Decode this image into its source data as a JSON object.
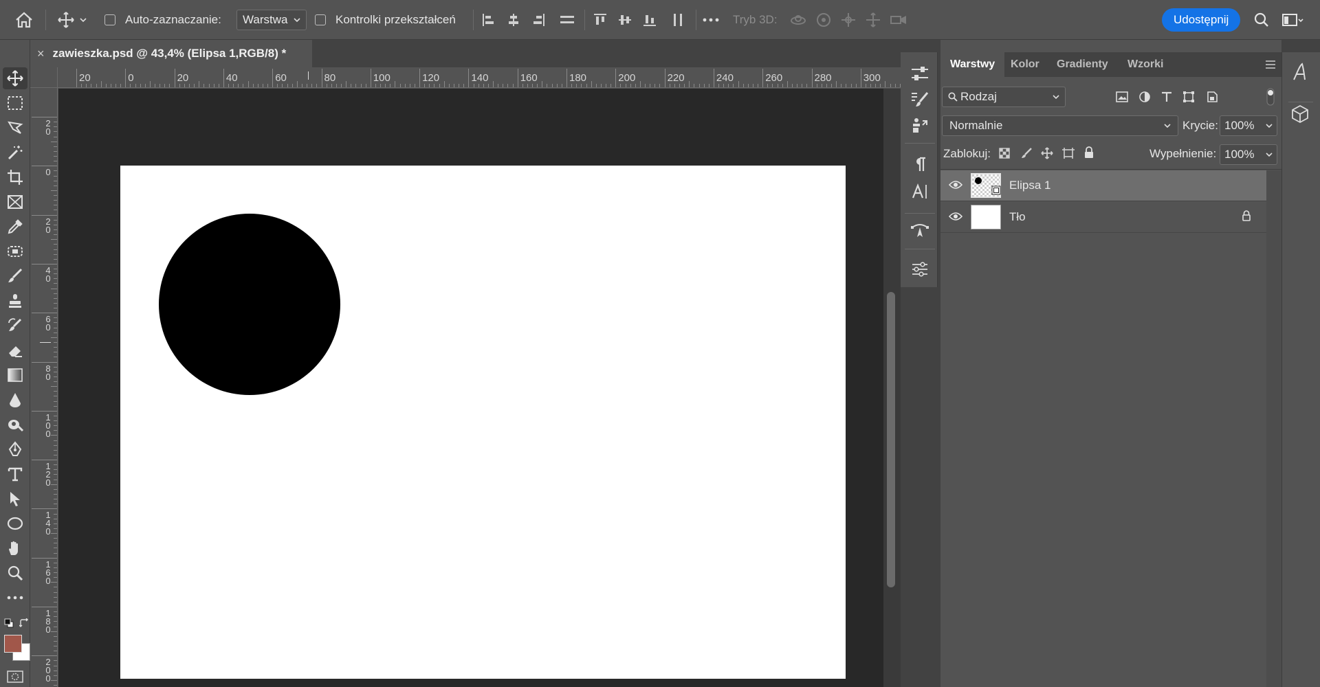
{
  "options_bar": {
    "auto_select_label": "Auto-zaznaczanie:",
    "auto_select_value": "Warstwa",
    "transform_controls_label": "Kontrolki przekształceń",
    "mode_3d_label": "Tryb 3D:",
    "share_button": "Udostępnij"
  },
  "document": {
    "tab_title": "zawieszka.psd @ 43,4% (Elipsa 1,RGB/8) *",
    "close_glyph": "×"
  },
  "rulers": {
    "horizontal_labels": [
      "20",
      "0",
      "20",
      "40",
      "60",
      "80",
      "100",
      "120",
      "140",
      "160",
      "180",
      "200",
      "220",
      "240",
      "260",
      "280",
      "300"
    ],
    "vertical_labels": [
      "20",
      "0",
      "20",
      "40",
      "60",
      "80",
      "100",
      "120",
      "140",
      "160",
      "180",
      "200"
    ]
  },
  "layers_panel": {
    "tabs": [
      "Warstwy",
      "Kolor",
      "Gradienty",
      "Wzorki"
    ],
    "filter_kind": "Rodzaj",
    "blend_mode": "Normalnie",
    "opacity_label": "Krycie:",
    "opacity_value": "100%",
    "lock_label": "Zablokuj:",
    "fill_label": "Wypełnienie:",
    "fill_value": "100%",
    "layers": [
      {
        "name": "Elipsa 1",
        "selected": true,
        "locked": false
      },
      {
        "name": "Tło",
        "selected": false,
        "locked": true
      }
    ]
  },
  "colors": {
    "foreground": "#a1574a",
    "background": "#ffffff",
    "accent": "#1473e6"
  },
  "icons": {
    "toolbar": [
      "move-tool-icon",
      "rectangular-marquee-icon",
      "lasso-icon",
      "magic-wand-icon",
      "crop-icon",
      "frame-icon",
      "eyedropper-icon",
      "healing-brush-icon",
      "brush-icon",
      "clone-stamp-icon",
      "history-brush-icon",
      "eraser-icon",
      "gradient-icon",
      "blur-icon",
      "dodge-icon",
      "pen-icon",
      "type-icon",
      "path-selection-icon",
      "ellipse-icon",
      "hand-icon",
      "zoom-icon",
      "more-tools-icon"
    ]
  }
}
